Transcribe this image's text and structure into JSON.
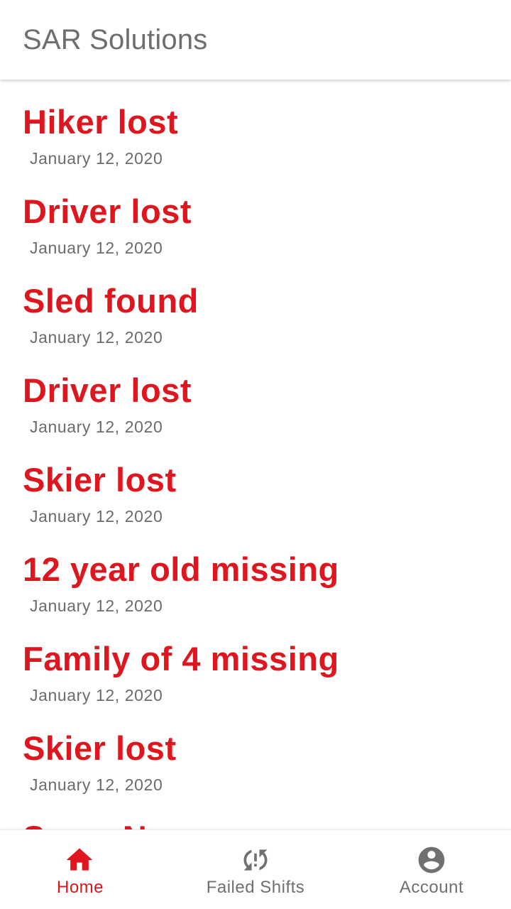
{
  "app_bar": {
    "title": "SAR Solutions"
  },
  "incidents": [
    {
      "title": "Hiker lost",
      "date": "January 12, 2020"
    },
    {
      "title": "Driver lost",
      "date": "January 12, 2020"
    },
    {
      "title": "Sled found",
      "date": "January 12, 2020"
    },
    {
      "title": "Driver lost",
      "date": "January 12, 2020"
    },
    {
      "title": "Skier lost",
      "date": "January 12, 2020"
    },
    {
      "title": "12 year old missing",
      "date": "January 12, 2020"
    },
    {
      "title": "Family of 4 missing",
      "date": "January 12, 2020"
    },
    {
      "title": "Skier lost",
      "date": "January 12, 2020"
    },
    {
      "title": "Snow N",
      "date": ""
    }
  ],
  "bottom_nav": {
    "items": [
      {
        "label": "Home",
        "icon": "home-icon",
        "active": true
      },
      {
        "label": "Failed Shifts",
        "icon": "sync-problem-icon",
        "active": false
      },
      {
        "label": "Account",
        "icon": "account-circle-icon",
        "active": false
      }
    ]
  },
  "colors": {
    "accent": "#e0161f",
    "inactive": "#707070",
    "title_gray": "#6e6e6e",
    "background": "#ffffff"
  }
}
